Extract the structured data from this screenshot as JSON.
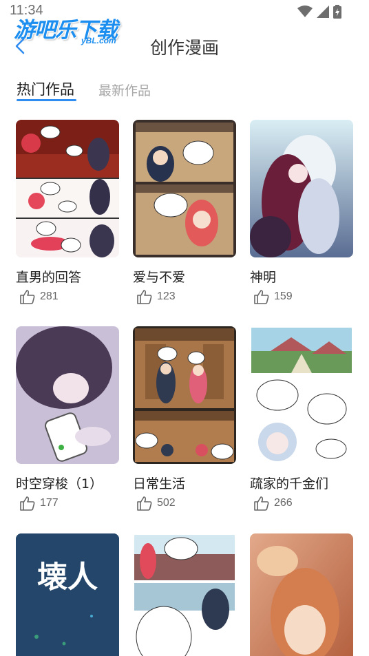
{
  "status_bar": {
    "time": "11:34"
  },
  "watermark": {
    "main": "游吧乐下载",
    "sub": "yBL.com"
  },
  "header": {
    "title": "创作漫画"
  },
  "tabs": [
    {
      "label": "热门作品",
      "active": true
    },
    {
      "label": "最新作品",
      "active": false
    }
  ],
  "accent_color": "#2f8cf0",
  "comics": [
    {
      "title": "直男的回答",
      "likes": "281"
    },
    {
      "title": "爱与不爱",
      "likes": "123"
    },
    {
      "title": "神明",
      "likes": "159"
    },
    {
      "title": "时空穿梭（1）",
      "likes": "177"
    },
    {
      "title": "日常生活",
      "likes": "502"
    },
    {
      "title": "疏家的千金们",
      "likes": "266"
    },
    {
      "title": "",
      "likes": "",
      "cover_text": "壊人"
    },
    {
      "title": "",
      "likes": ""
    },
    {
      "title": "",
      "likes": ""
    }
  ]
}
